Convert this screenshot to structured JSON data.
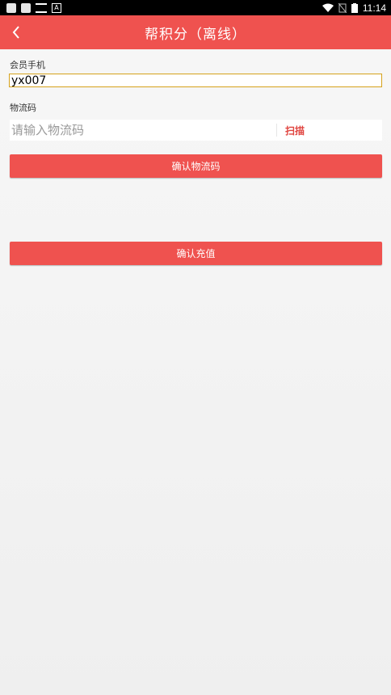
{
  "status_bar": {
    "time": "11:14",
    "icons": [
      "app-icon",
      "app-icon",
      "notification-icon",
      "a-icon",
      "wifi-icon",
      "no-sim-icon",
      "battery-icon"
    ]
  },
  "header": {
    "title": "帮积分（离线）",
    "back_icon": "chevron-left-icon",
    "color": "#ef524f"
  },
  "form": {
    "phone_label": "会员手机",
    "phone_value": "yx007",
    "logistic_label": "物流码",
    "logistic_placeholder": "请输入物流码",
    "scan_label": "扫描"
  },
  "buttons": {
    "confirm_logistic": "确认物流码",
    "confirm_recharge": "确认充值"
  }
}
